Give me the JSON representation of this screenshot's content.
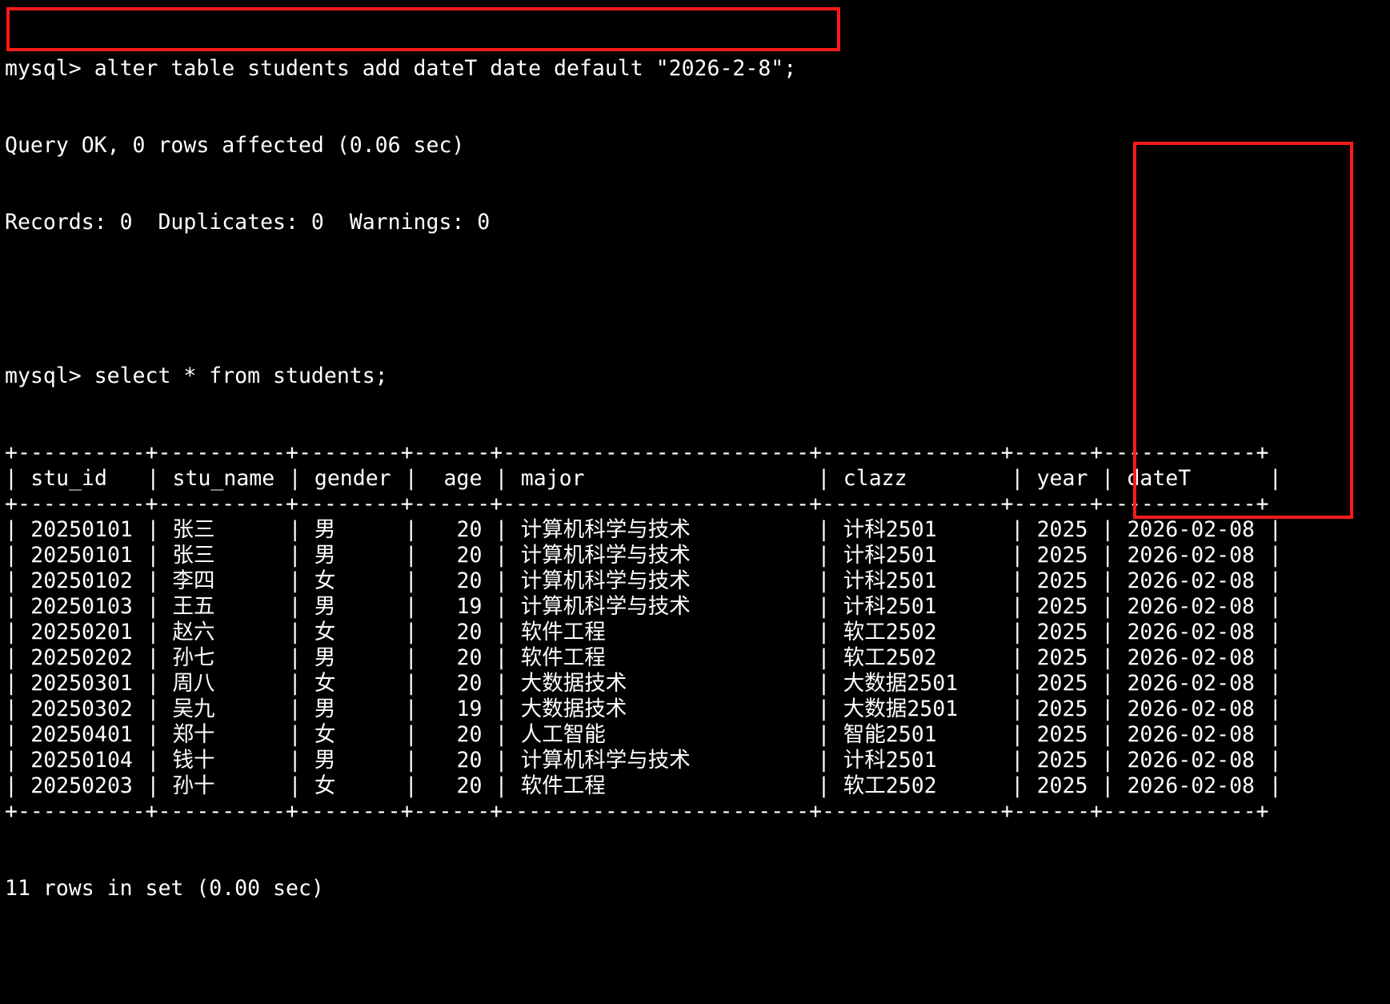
{
  "prompt": "mysql> ",
  "commands": {
    "alter": "alter table students add dateT date default \"2026-2-8\";",
    "select": "select * from students;"
  },
  "alter_result": {
    "query_ok": "Query OK, 0 rows affected (0.06 sec)",
    "records": "Records: 0  Duplicates: 0  Warnings: 0"
  },
  "table": {
    "border": "+----------+----------+--------+------+------------------------+--------------+------+------------+",
    "columns": [
      "stu_id",
      "stu_name",
      "gender",
      "age",
      "major",
      "clazz",
      "year",
      "dateT"
    ],
    "rows": [
      [
        "20250101",
        "张三",
        "男",
        "20",
        "计算机科学与技术",
        "计科2501",
        "2025",
        "2026-02-08"
      ],
      [
        "20250101",
        "张三",
        "男",
        "20",
        "计算机科学与技术",
        "计科2501",
        "2025",
        "2026-02-08"
      ],
      [
        "20250102",
        "李四",
        "女",
        "20",
        "计算机科学与技术",
        "计科2501",
        "2025",
        "2026-02-08"
      ],
      [
        "20250103",
        "王五",
        "男",
        "19",
        "计算机科学与技术",
        "计科2501",
        "2025",
        "2026-02-08"
      ],
      [
        "20250201",
        "赵六",
        "女",
        "20",
        "软件工程",
        "软工2502",
        "2025",
        "2026-02-08"
      ],
      [
        "20250202",
        "孙七",
        "男",
        "20",
        "软件工程",
        "软工2502",
        "2025",
        "2026-02-08"
      ],
      [
        "20250301",
        "周八",
        "女",
        "20",
        "大数据技术",
        "大数据2501",
        "2025",
        "2026-02-08"
      ],
      [
        "20250302",
        "吴九",
        "男",
        "19",
        "大数据技术",
        "大数据2501",
        "2025",
        "2026-02-08"
      ],
      [
        "20250401",
        "郑十",
        "女",
        "20",
        "人工智能",
        "智能2501",
        "2025",
        "2026-02-08"
      ],
      [
        "20250104",
        "钱十",
        "男",
        "20",
        "计算机科学与技术",
        "计科2501",
        "2025",
        "2026-02-08"
      ],
      [
        "20250203",
        "孙十",
        "女",
        "20",
        "软件工程",
        "软工2502",
        "2025",
        "2026-02-08"
      ]
    ]
  },
  "select_result": "11 rows in set (0.00 sec)",
  "colors": {
    "background": "#000000",
    "text": "#ffffff",
    "highlight": "#ff1a1a"
  }
}
